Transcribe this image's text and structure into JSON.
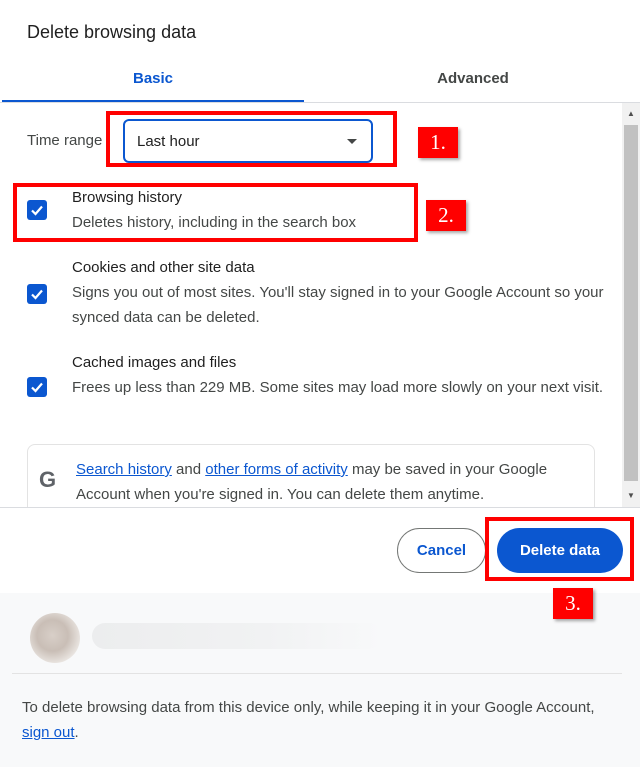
{
  "dialog": {
    "title": "Delete browsing data"
  },
  "tabs": [
    {
      "label": "Basic"
    },
    {
      "label": "Advanced"
    }
  ],
  "time_range": {
    "label": "Time range",
    "value": "Last hour"
  },
  "options": [
    {
      "title": "Browsing history",
      "description": "Deletes history, including in the search box",
      "checked": true
    },
    {
      "title": "Cookies and other site data",
      "description": "Signs you out of most sites. You'll stay signed in to your Google Account so your synced data can be deleted.",
      "checked": true
    },
    {
      "title": "Cached images and files",
      "description": "Frees up less than 229 MB. Some sites may load more slowly on your next visit.",
      "checked": true
    }
  ],
  "info": {
    "link1": "Search history",
    "and": " and ",
    "link2": "other forms of activity",
    "rest": " may be saved in your Google Account when you're signed in. You can delete them anytime."
  },
  "buttons": {
    "cancel": "Cancel",
    "delete": "Delete data"
  },
  "footer": {
    "text_before": "To delete browsing data from this device only, while keeping it in your Google Account, ",
    "link": "sign out",
    "text_after": "."
  },
  "annotations": {
    "one": "1.",
    "two": "2.",
    "three": "3."
  },
  "colors": {
    "accent": "#0b57d0",
    "annotation": "#ff0000"
  }
}
